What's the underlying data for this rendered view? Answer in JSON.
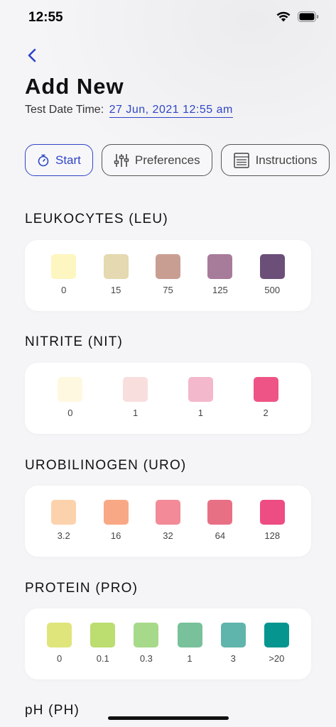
{
  "status_bar": {
    "time": "12:55"
  },
  "header": {
    "title": "Add New",
    "date_label": "Test Date Time:",
    "date_value": "27 Jun, 2021 12:55 am"
  },
  "actions": [
    {
      "label": "Start",
      "icon": "stopwatch-icon"
    },
    {
      "label": "Preferences",
      "icon": "sliders-icon"
    },
    {
      "label": "Instructions",
      "icon": "instructions-icon"
    }
  ],
  "sections": [
    {
      "title": "LEUKOCYTES (LEU)",
      "swatches": [
        {
          "label": "0",
          "color": "#fdf6c0"
        },
        {
          "label": "15",
          "color": "#e4d9b0"
        },
        {
          "label": "75",
          "color": "#c99e92"
        },
        {
          "label": "125",
          "color": "#a77b9a"
        },
        {
          "label": "500",
          "color": "#6b4f79"
        }
      ]
    },
    {
      "title": "NITRITE (NIT)",
      "swatches": [
        {
          "label": "0",
          "color": "#fff8e0"
        },
        {
          "label": "1",
          "color": "#f9dede"
        },
        {
          "label": "1",
          "color": "#f3b8cb"
        },
        {
          "label": "2",
          "color": "#ee5485"
        }
      ]
    },
    {
      "title": "UROBILINOGEN (URO)",
      "swatches": [
        {
          "label": "3.2",
          "color": "#fcd2ad"
        },
        {
          "label": "16",
          "color": "#f9a886"
        },
        {
          "label": "32",
          "color": "#f38a97"
        },
        {
          "label": "64",
          "color": "#e87085"
        },
        {
          "label": "128",
          "color": "#ed4d82"
        }
      ]
    },
    {
      "title": "PROTEIN (PRO)",
      "swatches": [
        {
          "label": "0",
          "color": "#dfe57b"
        },
        {
          "label": "0.1",
          "color": "#bcdd70"
        },
        {
          "label": "0.3",
          "color": "#a7d98a"
        },
        {
          "label": "1",
          "color": "#78c19a"
        },
        {
          "label": "3",
          "color": "#5fb5ab"
        },
        {
          "label": ">20",
          "color": "#06968f"
        }
      ]
    },
    {
      "title": "pH (PH)",
      "swatches": []
    }
  ],
  "colors": {
    "accent": "#2f45c6"
  }
}
